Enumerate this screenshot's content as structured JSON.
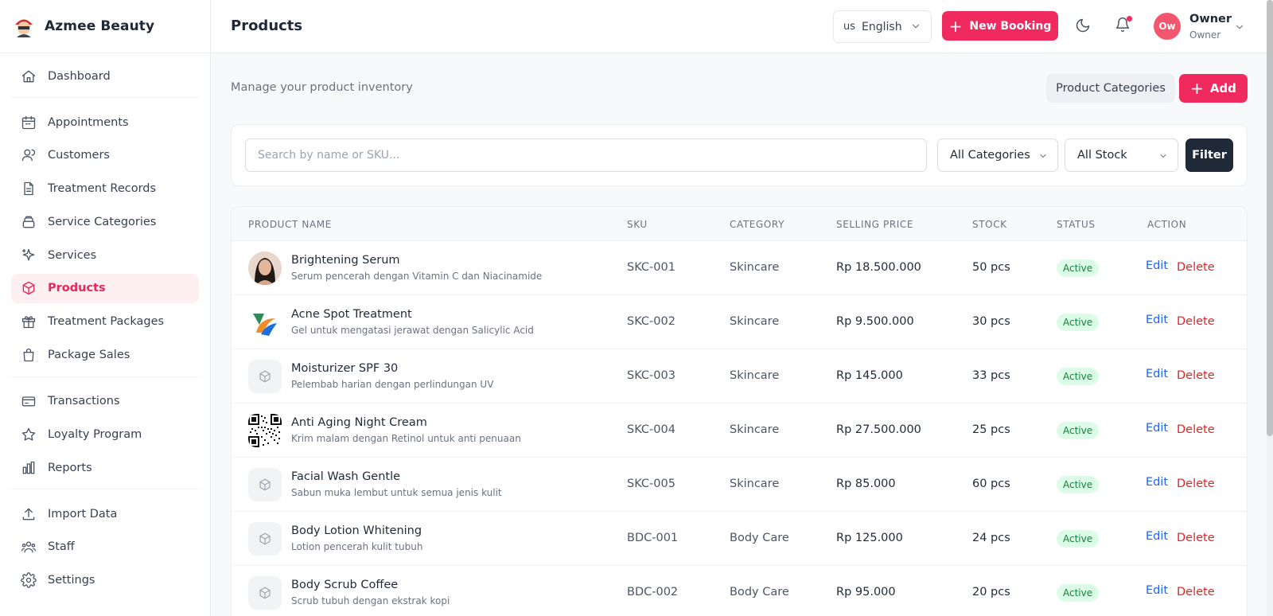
{
  "brand": {
    "name": "Azmee Beauty"
  },
  "sidebar": {
    "groups": [
      [
        {
          "label": "Dashboard",
          "icon": "home-icon"
        }
      ],
      [
        {
          "label": "Appointments",
          "icon": "calendar-icon"
        },
        {
          "label": "Customers",
          "icon": "users-icon"
        },
        {
          "label": "Treatment Records",
          "icon": "file-icon"
        },
        {
          "label": "Service Categories",
          "icon": "layers-icon"
        },
        {
          "label": "Services",
          "icon": "sparkles-icon"
        },
        {
          "label": "Products",
          "icon": "box-icon",
          "active": true
        },
        {
          "label": "Treatment Packages",
          "icon": "gift-icon"
        },
        {
          "label": "Package Sales",
          "icon": "bag-icon"
        }
      ],
      [
        {
          "label": "Transactions",
          "icon": "card-icon"
        },
        {
          "label": "Loyalty Program",
          "icon": "star-icon"
        },
        {
          "label": "Reports",
          "icon": "chart-icon"
        }
      ],
      [
        {
          "label": "Import Data",
          "icon": "upload-icon"
        },
        {
          "label": "Staff",
          "icon": "staff-icon"
        },
        {
          "label": "Settings",
          "icon": "gear-icon"
        }
      ]
    ]
  },
  "header": {
    "title": "Products",
    "language": {
      "flag": "us",
      "label": "English"
    },
    "new_booking_label": "New Booking",
    "user": {
      "initials": "Ow",
      "name": "Owner",
      "role": "Owner"
    }
  },
  "main": {
    "subtitle": "Manage your product inventory",
    "categories_button": "Product Categories",
    "add_button": "Add",
    "filters": {
      "search_placeholder": "Search by name or SKU...",
      "category_value": "All Categories",
      "stock_value": "All Stock",
      "filter_button": "Filter"
    },
    "table": {
      "columns": [
        "PRODUCT NAME",
        "SKU",
        "CATEGORY",
        "SELLING PRICE",
        "STOCK",
        "STATUS",
        "ACTION"
      ],
      "edit_label": "Edit",
      "delete_label": "Delete",
      "rows": [
        {
          "name": "Brightening Serum",
          "desc": "Serum pencerah dengan Vitamin C dan Niacinamide",
          "sku": "SKC-001",
          "category": "Skincare",
          "price": "Rp 18.500.000",
          "stock": "50 pcs",
          "status": "Active",
          "thumb": "portrait"
        },
        {
          "name": "Acne Spot Treatment",
          "desc": "Gel untuk mengatasi jerawat dengan Salicylic Acid",
          "sku": "SKC-002",
          "category": "Skincare",
          "price": "Rp 9.500.000",
          "stock": "30 pcs",
          "status": "Active",
          "thumb": "logo"
        },
        {
          "name": "Moisturizer SPF 30",
          "desc": "Pelembab harian dengan perlindungan UV",
          "sku": "SKC-003",
          "category": "Skincare",
          "price": "Rp 145.000",
          "stock": "33 pcs",
          "status": "Active",
          "thumb": "box"
        },
        {
          "name": "Anti Aging Night Cream",
          "desc": "Krim malam dengan Retinol untuk anti penuaan",
          "sku": "SKC-004",
          "category": "Skincare",
          "price": "Rp 27.500.000",
          "stock": "25 pcs",
          "status": "Active",
          "thumb": "qr"
        },
        {
          "name": "Facial Wash Gentle",
          "desc": "Sabun muka lembut untuk semua jenis kulit",
          "sku": "SKC-005",
          "category": "Skincare",
          "price": "Rp 85.000",
          "stock": "60 pcs",
          "status": "Active",
          "thumb": "box"
        },
        {
          "name": "Body Lotion Whitening",
          "desc": "Lotion pencerah kulit tubuh",
          "sku": "BDC-001",
          "category": "Body Care",
          "price": "Rp 125.000",
          "stock": "24 pcs",
          "status": "Active",
          "thumb": "box"
        },
        {
          "name": "Body Scrub Coffee",
          "desc": "Scrub tubuh dengan ekstrak kopi",
          "sku": "BDC-002",
          "category": "Body Care",
          "price": "Rp 95.000",
          "stock": "20 pcs",
          "status": "Active",
          "thumb": "box"
        }
      ]
    }
  },
  "colors": {
    "accent": "#f02a5e",
    "dark": "#1f2937",
    "active_bg": "#fdeff2",
    "badge_bg": "#dcfce7",
    "badge_fg": "#15803d",
    "edit": "#2563eb",
    "delete": "#dc2626"
  }
}
